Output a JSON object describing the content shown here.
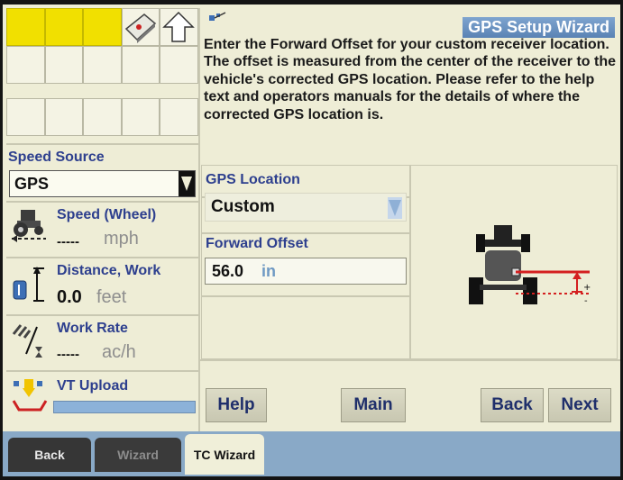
{
  "header": {
    "title": "GPS Setup Wizard"
  },
  "instructions": "Enter the Forward Offset for your custom receiver location. The offset is measured from the center of the receiver to the vehicle's corrected GPS location. Please refer to the help text and operators manuals for the details of where the corrected GPS location is.",
  "sidebar": {
    "speed_source": {
      "label": "Speed Source",
      "value": "GPS"
    },
    "speed": {
      "label": "Speed (Wheel)",
      "value": "-----",
      "unit": "mph"
    },
    "distance": {
      "label": "Distance, Work",
      "value": "0.0",
      "unit": "feet"
    },
    "work_rate": {
      "label": "Work Rate",
      "value": "-----",
      "unit": "ac/h"
    },
    "vt_upload": {
      "label": "VT Upload",
      "progress_fraction": 1.0
    }
  },
  "form": {
    "gps_location": {
      "label": "GPS Location",
      "value": "Custom"
    },
    "forward_offset": {
      "label": "Forward Offset",
      "value": "56.0",
      "unit": "in"
    }
  },
  "buttons": {
    "help": "Help",
    "main": "Main",
    "back": "Back",
    "next": "Next"
  },
  "tabs": [
    {
      "label": "Back",
      "state": "normal"
    },
    {
      "label": "Wizard",
      "state": "disabled"
    },
    {
      "label": "TC Wizard",
      "state": "active"
    }
  ],
  "colors": {
    "accent_yellow": "#f1e000",
    "title_blue": "#5a83b4",
    "label_blue": "#2d3f8e",
    "offset_red": "#d42020"
  }
}
